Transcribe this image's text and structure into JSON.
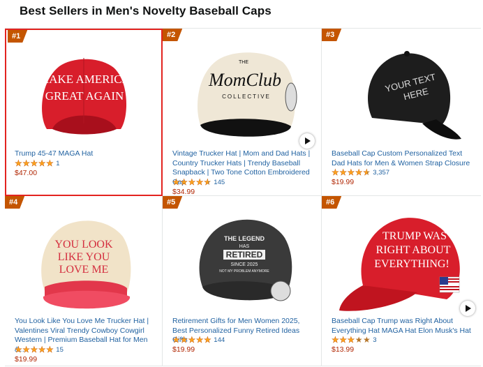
{
  "page": {
    "title": "Best Sellers in Men's Novelty Baseball Caps"
  },
  "colors": {
    "badge": "#c45500",
    "link": "#2162a1",
    "price": "#b12704",
    "star": "#ffa41c",
    "selection": "#e3231f"
  },
  "products": [
    {
      "rank": "#1",
      "title": "Trump 45-47 MAGA Hat",
      "rating": 5.0,
      "reviews": "1",
      "price": "$47.00",
      "image": "red-maga-cap-image",
      "cap_text": [
        "MAKE AMERICA",
        "GREAT AGAIN"
      ],
      "has_video": false,
      "selected": true
    },
    {
      "rank": "#2",
      "title": "Vintage Trucker Hat | Mom and Dad Hats | Country Trucker Hats | Trendy Baseball Snapback | Two Tone Cotton Embroidered Cap",
      "rating": 4.5,
      "reviews": "145",
      "price": "$34.99",
      "image": "cream-black-trucker-cap-image",
      "cap_text": [
        "THE",
        "MomClub",
        "COLLECTIVE"
      ],
      "has_video": true,
      "selected": false
    },
    {
      "rank": "#3",
      "title": "Baseball Cap Custom Personalized Text Dad Hats for Men & Women Strap Closure",
      "rating": 4.5,
      "reviews": "3,357",
      "price": "$19.99",
      "image": "black-custom-text-cap-image",
      "cap_text": [
        "YOUR TEXT",
        "HERE"
      ],
      "has_video": false,
      "selected": false
    },
    {
      "rank": "#4",
      "title": "You Look Like You Love Me Trucker Hat | Valentines Viral Trendy Cowboy Cowgirl Western | Premium Baseball Hat for Men &…",
      "rating": 5.0,
      "reviews": "15",
      "price": "$19.99",
      "image": "cream-pink-trucker-cap-image",
      "cap_text": [
        "YOU LOOK",
        "LIKE YOU",
        "LOVE ME"
      ],
      "has_video": false,
      "selected": false
    },
    {
      "rank": "#5",
      "title": "Retirement Gifts for Men Women 2025, Best Personalized Funny Retired Ideas Gifts",
      "rating": 5.0,
      "reviews": "144",
      "price": "$19.99",
      "image": "black-retired-cap-image",
      "cap_text": [
        "THE LEGEND",
        "HAS",
        "RETIRED",
        "SINCE 2025",
        "NOT MY PROBLEM ANYMORE"
      ],
      "has_video": false,
      "selected": false
    },
    {
      "rank": "#6",
      "title": "Baseball Cap Trump was Right About Everything Hat MAGA Hat Elon Musk's Hat",
      "rating": 3.0,
      "reviews": "3",
      "price": "$13.99",
      "image": "red-trump-right-cap-image",
      "cap_text": [
        "TRUMP WAS",
        "RIGHT ABOUT",
        "EVERYTHING!"
      ],
      "has_video": true,
      "selected": false
    }
  ]
}
